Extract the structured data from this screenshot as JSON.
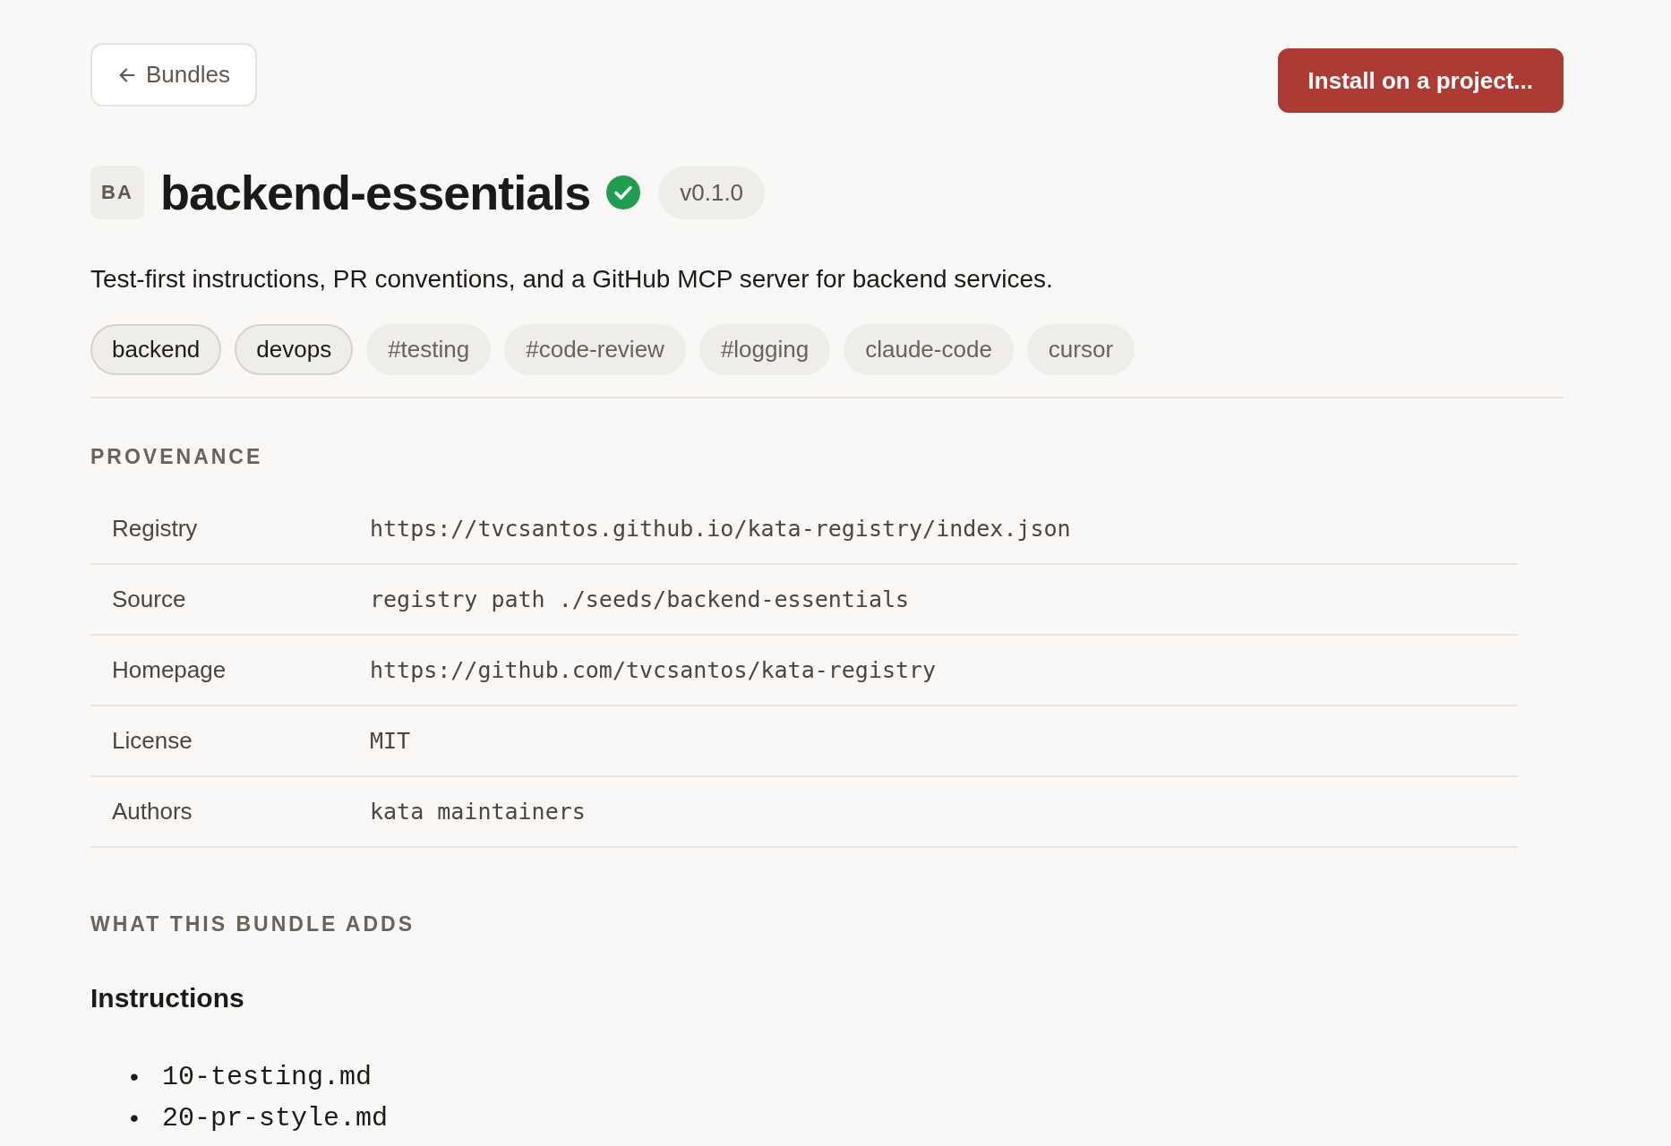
{
  "back_button": {
    "label": "Bundles"
  },
  "install_button": {
    "label": "Install on a project..."
  },
  "header": {
    "avatar": "BA",
    "title": "backend-essentials",
    "verified": true,
    "version": "v0.1.0"
  },
  "description": "Test-first instructions, PR conventions, and a GitHub MCP server for backend services.",
  "tags": [
    {
      "label": "backend",
      "selected": true
    },
    {
      "label": "devops",
      "selected": true
    },
    {
      "label": "#testing",
      "selected": false
    },
    {
      "label": "#code-review",
      "selected": false
    },
    {
      "label": "#logging",
      "selected": false
    },
    {
      "label": "claude-code",
      "selected": false
    },
    {
      "label": "cursor",
      "selected": false
    }
  ],
  "provenance": {
    "heading": "PROVENANCE",
    "rows": [
      {
        "label": "Registry",
        "value": "https://tvcsantos.github.io/kata-registry/index.json"
      },
      {
        "label": "Source",
        "value": "registry path ./seeds/backend-essentials"
      },
      {
        "label": "Homepage",
        "value": "https://github.com/tvcsantos/kata-registry"
      },
      {
        "label": "License",
        "value": "MIT"
      },
      {
        "label": "Authors",
        "value": "kata maintainers"
      }
    ]
  },
  "adds": {
    "heading": "WHAT THIS BUNDLE ADDS",
    "sections": [
      {
        "title": "Instructions",
        "items": [
          {
            "bullet": "•",
            "text": "10-testing.md"
          },
          {
            "bullet": "•",
            "text": "20-pr-style.md"
          }
        ]
      }
    ]
  }
}
